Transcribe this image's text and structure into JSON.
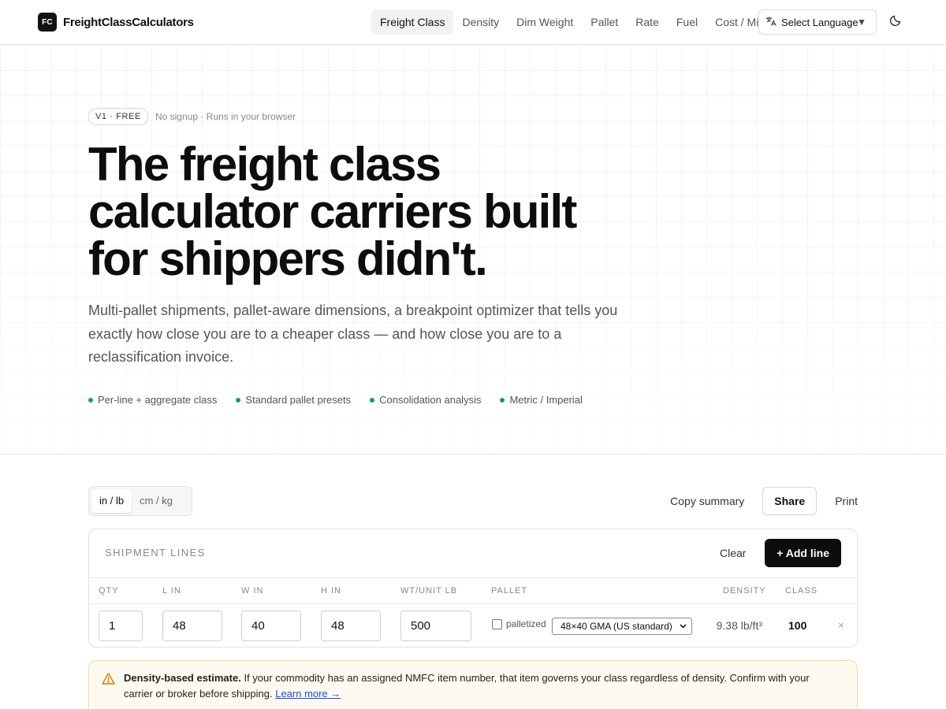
{
  "header": {
    "logo_text": "FC",
    "brand": "FreightClassCalculators",
    "nav": [
      {
        "label": "Freight Class",
        "active": true
      },
      {
        "label": "Density",
        "active": false
      },
      {
        "label": "Dim Weight",
        "active": false
      },
      {
        "label": "Pallet",
        "active": false
      },
      {
        "label": "Rate",
        "active": false
      },
      {
        "label": "Fuel",
        "active": false
      },
      {
        "label": "Cost / Mi",
        "active": false
      }
    ],
    "language_select": "Select Language",
    "theme_icon": "moon-icon"
  },
  "hero": {
    "badge": "V1 · FREE",
    "badge_note": "No signup · Runs in your browser",
    "title_lines": [
      "The freight class",
      "calculator carriers built",
      "for shippers didn't."
    ],
    "subtitle": "Multi-pallet shipments, pallet-aware dimensions, a breakpoint optimizer that tells you exactly how close you are to a cheaper class — and how close you are to a reclassification invoice.",
    "features": [
      "Per-line + aggregate class",
      "Standard pallet presets",
      "Consolidation analysis",
      "Metric / Imperial"
    ],
    "accent_color": "#16a34a"
  },
  "toolbar": {
    "units": [
      {
        "label": "in / lb",
        "active": true
      },
      {
        "label": "cm / kg",
        "active": false
      }
    ],
    "copy_summary": "Copy summary",
    "share": "Share",
    "print": "Print"
  },
  "shipment": {
    "title": "SHIPMENT LINES",
    "clear": "Clear",
    "add_line": "+ Add line",
    "columns": {
      "qty": "QTY",
      "l": "L IN",
      "w": "W IN",
      "h": "H IN",
      "wt": "WT/UNIT LB",
      "pallet": "PALLET",
      "density": "DENSITY",
      "class": "CLASS"
    },
    "row": {
      "qty": "1",
      "l": "48",
      "w": "40",
      "h": "48",
      "wt": "500",
      "palletized_label": "palletized",
      "palletized": false,
      "pallet_type": "48×40 GMA (US standard)",
      "density": "9.38 lb/ft³",
      "class": "100",
      "remove": "×"
    }
  },
  "notice": {
    "bold": "Density-based estimate.",
    "text": "If your commodity has an assigned NMFC item number, that item governs your class regardless of density. Confirm with your carrier or broker before shipping.",
    "link": "Learn more →",
    "icon": "warning-triangle-icon",
    "accent_color": "#d97706"
  }
}
